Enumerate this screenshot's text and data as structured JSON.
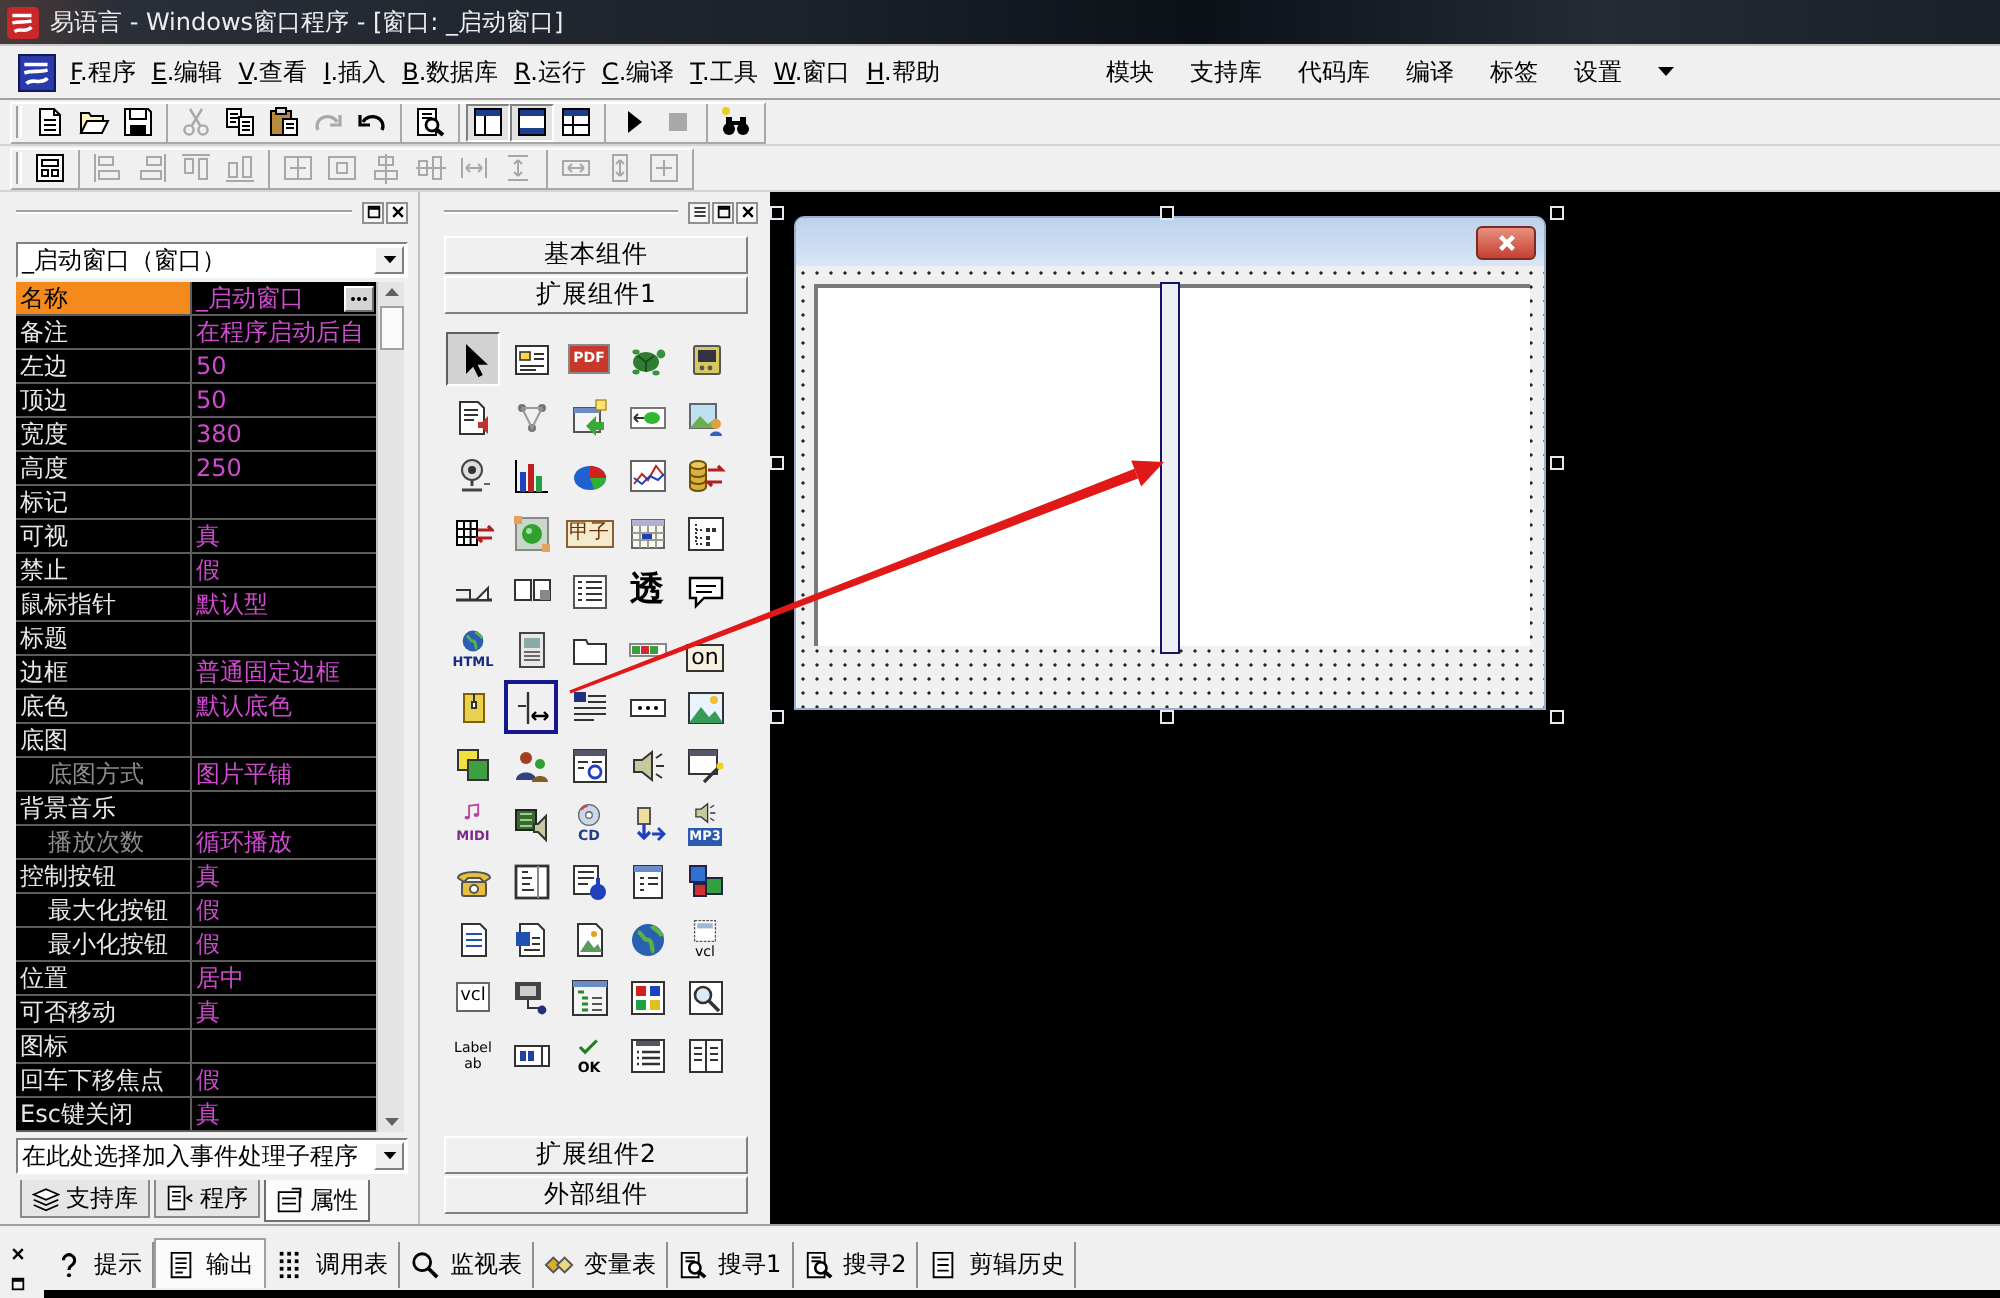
{
  "window": {
    "title": "易语言 - Windows窗口程序 - [窗口: _启动窗口]"
  },
  "menu": {
    "items": [
      {
        "key": "F",
        "label": ".程序"
      },
      {
        "key": "E",
        "label": ".编辑"
      },
      {
        "key": "V",
        "label": ".查看"
      },
      {
        "key": "I",
        "label": ".插入"
      },
      {
        "key": "B",
        "label": ".数据库"
      },
      {
        "key": "R",
        "label": ".运行"
      },
      {
        "key": "C",
        "label": ".编译"
      },
      {
        "key": "T",
        "label": ".工具"
      },
      {
        "key": "W",
        "label": ".窗口"
      },
      {
        "key": "H",
        "label": ".帮助"
      }
    ],
    "quick_links": [
      "模块",
      "支持库",
      "代码库",
      "编译",
      "标签",
      "设置"
    ]
  },
  "toolbars": [
    {
      "groups": [
        {
          "items": [
            {
              "disabled": false,
              "pressed": false
            },
            {
              "disabled": false,
              "pressed": false
            },
            {
              "disabled": false,
              "pressed": false
            }
          ]
        },
        {
          "items": [
            {
              "disabled": true,
              "pressed": false
            },
            {
              "disabled": false,
              "pressed": false
            },
            {
              "disabled": false,
              "pressed": false
            },
            {
              "disabled": true,
              "pressed": false
            },
            {
              "disabled": false,
              "pressed": false
            }
          ]
        },
        {
          "items": [
            {
              "disabled": false,
              "pressed": false
            }
          ]
        },
        {
          "items": [
            {
              "disabled": false,
              "pressed": true
            },
            {
              "disabled": false,
              "pressed": true
            },
            {
              "disabled": false,
              "pressed": false
            }
          ]
        },
        {
          "items": [
            {
              "disabled": false,
              "pressed": false
            },
            {
              "disabled": true,
              "pressed": false
            }
          ]
        },
        {
          "items": [
            {
              "disabled": false,
              "pressed": false
            }
          ]
        }
      ]
    },
    {
      "groups": [
        {
          "items": [
            {
              "disabled": false,
              "pressed": false
            }
          ]
        },
        {
          "items": [
            {
              "disabled": true,
              "pressed": false
            },
            {
              "disabled": true,
              "pressed": false
            },
            {
              "disabled": true,
              "pressed": false
            },
            {
              "disabled": true,
              "pressed": false
            }
          ]
        },
        {
          "items": [
            {
              "disabled": true,
              "pressed": false
            },
            {
              "disabled": true,
              "pressed": false
            },
            {
              "disabled": true,
              "pressed": false
            },
            {
              "disabled": true,
              "pressed": false
            },
            {
              "disabled": true,
              "pressed": false
            },
            {
              "disabled": true,
              "pressed": false
            }
          ]
        },
        {
          "items": [
            {
              "disabled": true,
              "pressed": false
            },
            {
              "disabled": true,
              "pressed": false
            },
            {
              "disabled": true,
              "pressed": false
            }
          ]
        }
      ]
    }
  ],
  "property_panel": {
    "object_select": "_启动窗口（窗口）",
    "properties": [
      {
        "label": "名称",
        "value": "_启动窗口",
        "selected": true,
        "disabled": false
      },
      {
        "label": "备注",
        "value": "在程序启动后自",
        "selected": false,
        "disabled": false
      },
      {
        "label": "左边",
        "value": "50",
        "selected": false,
        "disabled": false
      },
      {
        "label": "顶边",
        "value": "50",
        "selected": false,
        "disabled": false
      },
      {
        "label": "宽度",
        "value": "380",
        "selected": false,
        "disabled": false
      },
      {
        "label": "高度",
        "value": "250",
        "selected": false,
        "disabled": false
      },
      {
        "label": "标记",
        "selected": false,
        "disabled": false
      },
      {
        "label": "可视",
        "value": "真",
        "selected": false,
        "disabled": false
      },
      {
        "label": "禁止",
        "value": "假",
        "selected": false,
        "disabled": false
      },
      {
        "label": "鼠标指针",
        "value": "默认型",
        "selected": false,
        "disabled": false
      },
      {
        "label": "标题",
        "selected": false,
        "disabled": false
      },
      {
        "label": "边框",
        "value": "普通固定边框",
        "selected": false,
        "disabled": false
      },
      {
        "label": "底色",
        "value": "默认底色",
        "selected": false,
        "disabled": false
      },
      {
        "label": "底图",
        "selected": false,
        "disabled": false,
        "children": [
          {
            "label": "底图方式",
            "value": "图片平铺",
            "selected": false,
            "disabled": true
          }
        ]
      },
      {
        "label": "背景音乐",
        "selected": false,
        "disabled": false,
        "children": [
          {
            "label": "播放次数",
            "value": "循环播放",
            "selected": false,
            "disabled": true
          }
        ]
      },
      {
        "label": "控制按钮",
        "value": "真",
        "selected": false,
        "disabled": false,
        "children": [
          {
            "label": "最大化按钮",
            "value": "假",
            "selected": false,
            "disabled": false
          },
          {
            "label": "最小化按钮",
            "value": "假",
            "selected": false,
            "disabled": false
          }
        ]
      },
      {
        "label": "位置",
        "value": "居中",
        "selected": false,
        "disabled": false
      },
      {
        "label": "可否移动",
        "value": "真",
        "selected": false,
        "disabled": false
      },
      {
        "label": "图标",
        "selected": false,
        "disabled": false
      },
      {
        "label": "回车下移焦点",
        "value": "假",
        "selected": false,
        "disabled": false
      },
      {
        "label": "Esc键关闭",
        "value": "真",
        "selected": false,
        "disabled": false
      }
    ],
    "event_select": "在此处选择加入事件处理子程序",
    "tabs": [
      {
        "label": "支持库",
        "selected": false
      },
      {
        "label": "程序",
        "selected": false
      },
      {
        "label": "属性",
        "selected": true
      }
    ]
  },
  "component_panel": {
    "top_categories": [
      "基本组件",
      "扩展组件1"
    ],
    "items": [
      {
        "selected": true,
        "highlighted": false
      },
      {
        "selected": false,
        "highlighted": false
      },
      {
        "selected": false,
        "highlighted": false,
        "label": "PDF"
      },
      {
        "selected": false,
        "highlighted": false
      },
      {
        "selected": false,
        "highlighted": false
      },
      {
        "selected": false,
        "highlighted": false
      },
      {
        "selected": false,
        "highlighted": false
      },
      {
        "selected": false,
        "highlighted": false
      },
      {
        "selected": false,
        "highlighted": false
      },
      {
        "selected": false,
        "highlighted": false
      },
      {
        "selected": false,
        "highlighted": false
      },
      {
        "selected": false,
        "highlighted": false
      },
      {
        "selected": false,
        "highlighted": false
      },
      {
        "selected": false,
        "highlighted": false
      },
      {
        "selected": false,
        "highlighted": false
      },
      {
        "selected": false,
        "highlighted": false
      },
      {
        "selected": false,
        "highlighted": false
      },
      {
        "selected": false,
        "highlighted": false,
        "label": "甲子"
      },
      {
        "selected": false,
        "highlighted": false
      },
      {
        "selected": false,
        "highlighted": false
      },
      {
        "selected": false,
        "highlighted": false
      },
      {
        "selected": false,
        "highlighted": false
      },
      {
        "selected": false,
        "highlighted": false
      },
      {
        "selected": false,
        "highlighted": false,
        "label": "透"
      },
      {
        "selected": false,
        "highlighted": false
      },
      {
        "selected": false,
        "highlighted": false,
        "label": "HTML"
      },
      {
        "selected": false,
        "highlighted": false
      },
      {
        "selected": false,
        "highlighted": false
      },
      {
        "selected": false,
        "highlighted": false
      },
      {
        "selected": false,
        "highlighted": false,
        "label": "on"
      },
      {
        "selected": false,
        "highlighted": false
      },
      {
        "selected": false,
        "highlighted": true
      },
      {
        "selected": false,
        "highlighted": false
      },
      {
        "selected": false,
        "highlighted": false
      },
      {
        "selected": false,
        "highlighted": false
      },
      {
        "selected": false,
        "highlighted": false
      },
      {
        "selected": false,
        "highlighted": false
      },
      {
        "selected": false,
        "highlighted": false
      },
      {
        "selected": false,
        "highlighted": false
      },
      {
        "selected": false,
        "highlighted": false
      },
      {
        "selected": false,
        "highlighted": false,
        "label": "MIDI"
      },
      {
        "selected": false,
        "highlighted": false
      },
      {
        "selected": false,
        "highlighted": false,
        "label": "CD"
      },
      {
        "selected": false,
        "highlighted": false
      },
      {
        "selected": false,
        "highlighted": false,
        "label": "MP3"
      },
      {
        "selected": false,
        "highlighted": false
      },
      {
        "selected": false,
        "highlighted": false
      },
      {
        "selected": false,
        "highlighted": false
      },
      {
        "selected": false,
        "highlighted": false
      },
      {
        "selected": false,
        "highlighted": false
      },
      {
        "selected": false,
        "highlighted": false
      },
      {
        "selected": false,
        "highlighted": false
      },
      {
        "selected": false,
        "highlighted": false
      },
      {
        "selected": false,
        "highlighted": false
      },
      {
        "selected": false,
        "highlighted": false,
        "label": "vcl"
      },
      {
        "selected": false,
        "highlighted": false,
        "label": "vcl"
      },
      {
        "selected": false,
        "highlighted": false
      },
      {
        "selected": false,
        "highlighted": false
      },
      {
        "selected": false,
        "highlighted": false
      },
      {
        "selected": false,
        "highlighted": false
      },
      {
        "selected": false,
        "highlighted": false,
        "label": "Label ab"
      },
      {
        "selected": false,
        "highlighted": false
      },
      {
        "selected": false,
        "highlighted": false,
        "label": "OK"
      },
      {
        "selected": false,
        "highlighted": false
      },
      {
        "selected": false,
        "highlighted": false
      }
    ],
    "bottom_categories": [
      "扩展组件2",
      "外部组件"
    ]
  },
  "designer": {
    "form": {
      "selected": true
    }
  },
  "bottom_tabs": [
    {
      "label": "提示",
      "selected": false
    },
    {
      "label": "输出",
      "selected": true
    },
    {
      "label": "调用表",
      "selected": false
    },
    {
      "label": "监视表",
      "selected": false
    },
    {
      "label": "变量表",
      "selected": false
    },
    {
      "label": "搜寻1",
      "selected": false
    },
    {
      "label": "搜寻2",
      "selected": false
    },
    {
      "label": "剪辑历史",
      "selected": false
    }
  ]
}
